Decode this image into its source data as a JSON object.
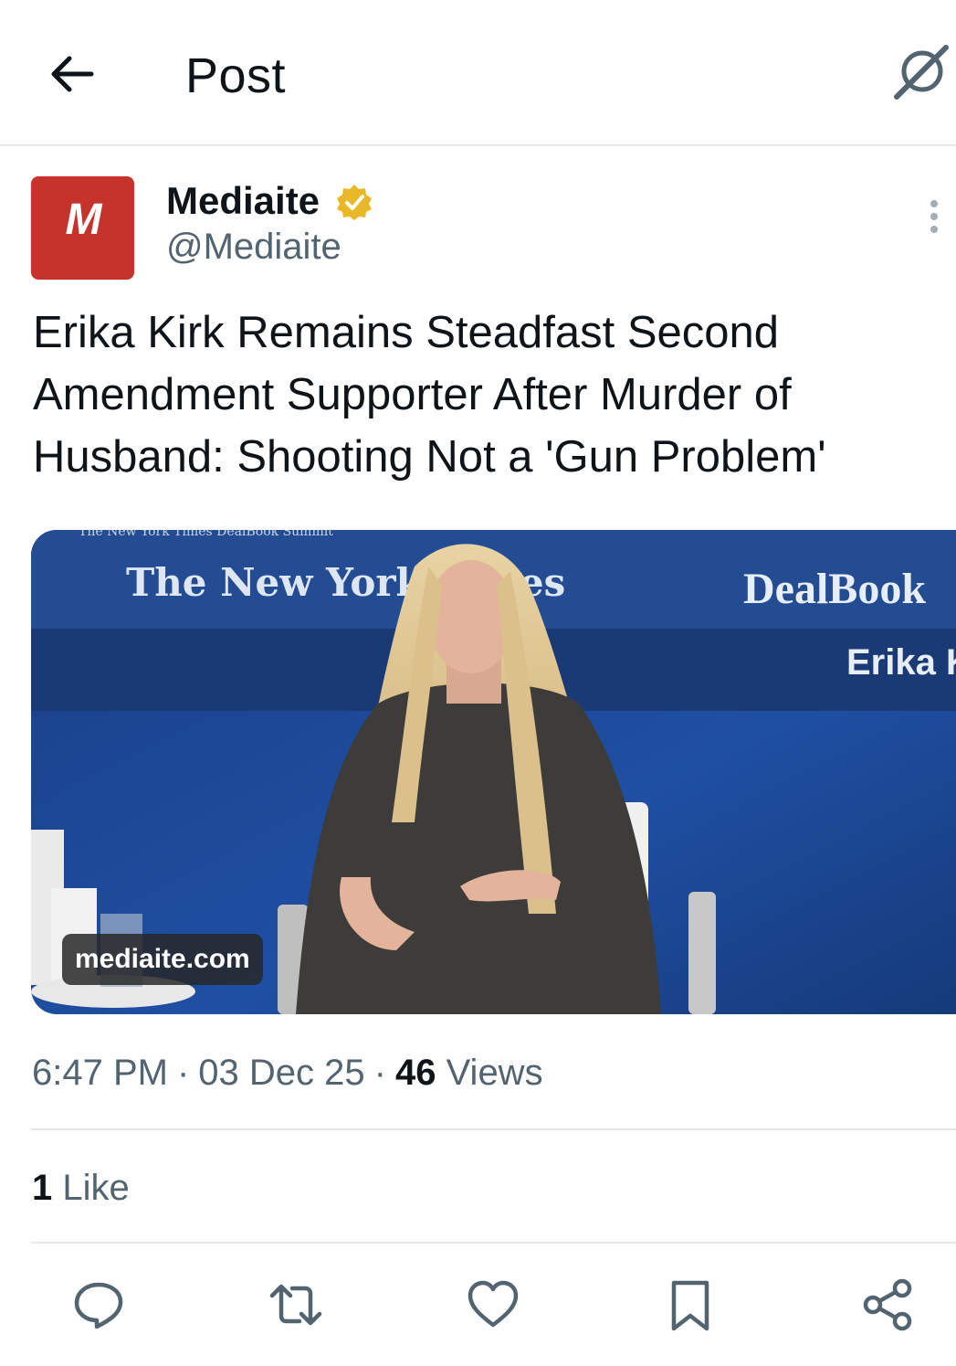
{
  "header": {
    "title": "Post",
    "back_icon": "arrow-left-icon",
    "grok_icon": "grok-icon"
  },
  "author": {
    "avatar_letter": "M",
    "avatar_color": "#c6332a",
    "name": "Mediaite",
    "verified_color": "#e8b829",
    "handle": "@Mediaite"
  },
  "post": {
    "text": "Erika Kirk Remains Steadfast Second Amendment Supporter After Murder of Husband: Shooting Not a 'Gun Problem'",
    "media": {
      "source": "mediaite.com",
      "banner_small": "The New York Times DealBook Summit",
      "banner_logo": "The New York Times",
      "brand": "DealBook",
      "lower_third": "Erika K"
    }
  },
  "meta": {
    "time": "6:47 PM",
    "date": "03 Dec 25",
    "views_count": "46",
    "views_label": "Views",
    "separator": "·"
  },
  "engagement": {
    "likes_count": "1",
    "likes_label": "Like"
  },
  "actions": [
    "reply-icon",
    "repost-icon",
    "like-icon",
    "bookmark-icon",
    "share-icon"
  ]
}
